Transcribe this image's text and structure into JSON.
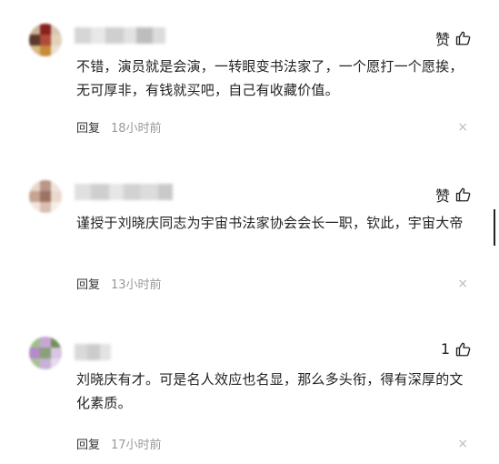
{
  "comments": [
    {
      "avatar_colors": [
        "#c9b49a",
        "#8a1f1f",
        "#d8c5b0",
        "#5a3a2a",
        "#b24a3a",
        "#e2d2b8",
        "#d9b88a",
        "#c58b3a",
        "#ece1d2"
      ],
      "username_colors": [
        "#d6d6d6",
        "#e8e8e8",
        "#cfcfcf",
        "#e2e2e2",
        "#bdbdbd",
        "#dcdcdc"
      ],
      "like_label": "赞",
      "text": "不错，演员就是会演，一转眼变书法家了，一个愿打一个愿挨，无可厚非，有钱就买吧，自己有收藏价值。",
      "reply_label": "回复",
      "time": "18小时前",
      "close_symbol": "×"
    },
    {
      "avatar_colors": [
        "#e8d7c9",
        "#b99686",
        "#efe4db",
        "#c6a393",
        "#9c7466",
        "#ead9cc",
        "#f1e6de",
        "#d9bfb0",
        "#f5eee8"
      ],
      "username_colors": [
        "#e0e0e0",
        "#cfcfcf",
        "#e6e6e6",
        "#d2d2d2",
        "#dcdcdc",
        "#c9c9c9"
      ],
      "like_label": "赞",
      "text": "谨授于刘晓庆同志为宇宙书法家协会会长一职，钦此，宇宙大帝",
      "reply_label": "回复",
      "time": "13小时前",
      "close_symbol": "×"
    },
    {
      "avatar_colors": [
        "#9fbf8a",
        "#c7a6d6",
        "#6f8f5a",
        "#b58ac9",
        "#8aa07a",
        "#d8c6e2",
        "#a9c197",
        "#cbb0d9",
        "#e6dcec"
      ],
      "username_colors": [
        "#d9d9d9",
        "#cccccc",
        "#e3e3e3"
      ],
      "like_label": "1",
      "text": "刘晓庆有才。可是名人效应也名显，那么多头衔，得有深厚的文化素质。",
      "reply_label": "回复",
      "time": "17小时前",
      "close_symbol": "×"
    }
  ]
}
